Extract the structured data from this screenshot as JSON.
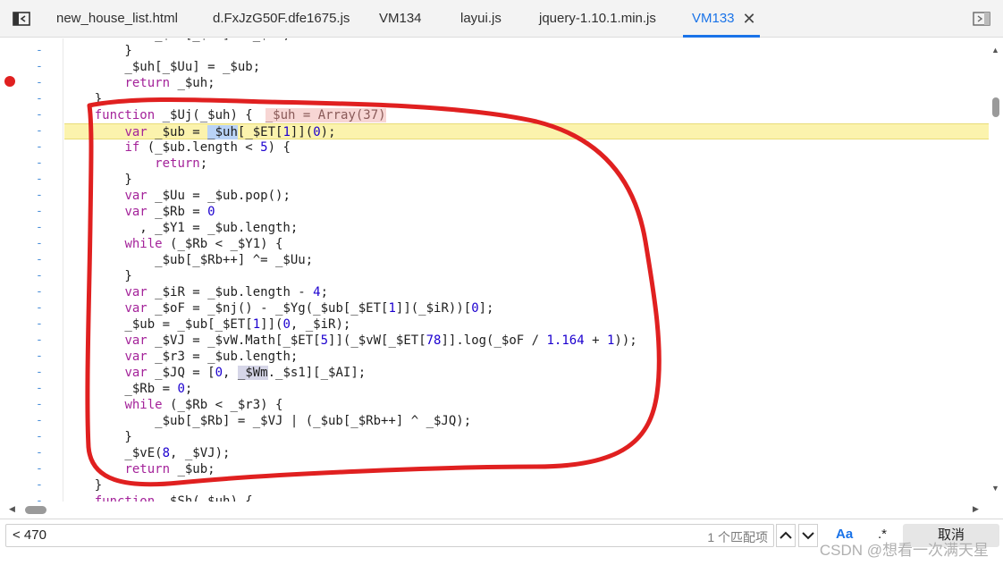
{
  "tabs": [
    {
      "label": "new_house_list.html"
    },
    {
      "label": "d.FxJzG50F.dfe1675.js"
    },
    {
      "label": "VM134"
    },
    {
      "label": "layui.js"
    },
    {
      "label": "jquery-1.10.1.min.js"
    },
    {
      "label": "VM133",
      "active": true
    }
  ],
  "icons": {
    "left_panel_toggle": "sidebar-toggle-icon",
    "right_panel_toggle": "panel-collapse-icon",
    "tab_close": "close-icon"
  },
  "gutter_marker": "-",
  "breakpoint_color": "#e02020",
  "highlight_color": "#fbf3ad",
  "accent_color": "#1a73e8",
  "annotation_color": "#e02020",
  "code_lines": [
    "            _$uh[_$ub] = _$ub;",
    "        }",
    "        _$uh[_$Uu] = _$ub;",
    "        return _$uh;",
    "    }",
    "    function _$Uj(_$uh) {",
    "        var _$ub = _$uh[_$ET[1]](0);",
    "        if (_$ub.length < 5) {",
    "            return;",
    "        }",
    "        var _$Uu = _$ub.pop();",
    "        var _$Rb = 0",
    "          , _$Y1 = _$ub.length;",
    "        while (_$Rb < _$Y1) {",
    "            _$ub[_$Rb++] ^= _$Uu;",
    "        }",
    "        var _$iR = _$ub.length - 4;",
    "        var _$oF = _$nj() - _$Yg(_$ub[_$ET[1]](_$iR))[0];",
    "        _$ub = _$ub[_$ET[1]](0, _$iR);",
    "        var _$VJ = _$vW.Math[_$ET[5]](_$vW[_$ET[78]].log(_$oF / 1.164 + 1));",
    "        var _$r3 = _$ub.length;",
    "        var _$JQ = [0, _$Wm._$s1][_$AI];",
    "        _$Rb = 0;",
    "        while (_$Rb < _$r3) {",
    "            _$ub[_$Rb] = _$VJ | (_$ub[_$Rb++] ^ _$JQ);",
    "        }",
    "        _$vE(8, _$VJ);",
    "        return _$ub;",
    "    }",
    "    function _$Sh(_$uh) {"
  ],
  "inline_value": "_$uh = Array(37)",
  "search": {
    "query": "< 470",
    "match_count": "1 个匹配项",
    "option_match_case": "Aa",
    "option_regex": ".*",
    "cancel_label": "取消"
  },
  "watermark": "CSDN @想看一次满天星"
}
